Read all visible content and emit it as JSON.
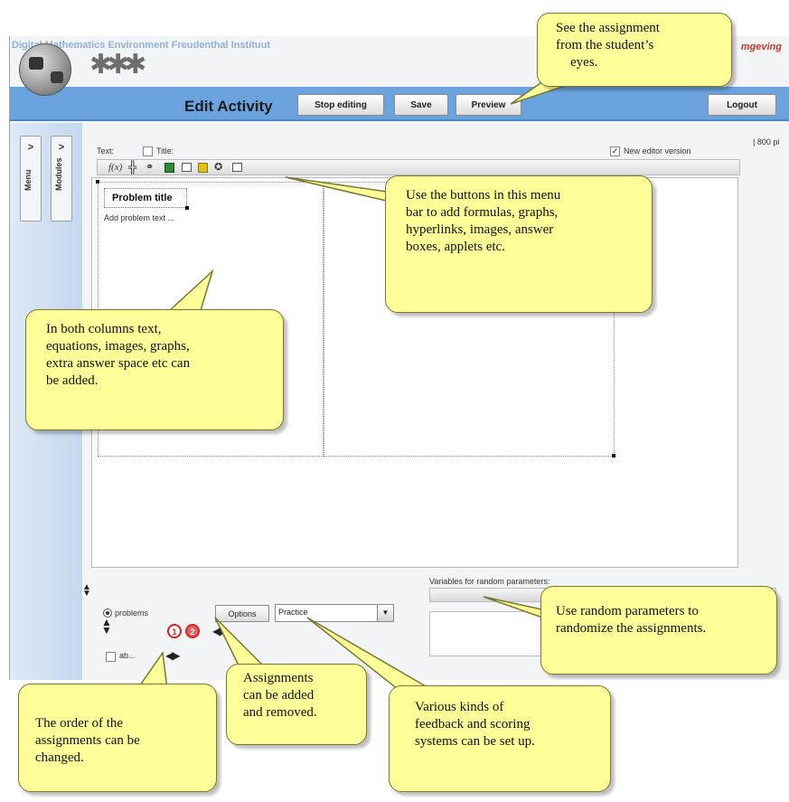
{
  "app": {
    "title": "Digital Mathematics Environment  Freudenthal Instituut",
    "title_right": "mgeving",
    "page_heading": "Edit Activity",
    "buttons": {
      "stop_editing": "Stop editing",
      "save": "Save",
      "preview": "Preview",
      "logout": "Logout"
    },
    "side_tabs": [
      {
        "chevron": ">",
        "label": "Menu"
      },
      {
        "chevron": ">",
        "label": "Modules"
      }
    ]
  },
  "editor": {
    "text_label": "Text:",
    "title_label": "Title:",
    "new_editor_label": "New editor version",
    "new_editor_checked": true,
    "size_label": "| 800 pi",
    "toolbar": {
      "formula": "f(x)",
      "icons": [
        "formula-icon",
        "graph-icon",
        "hyperlink-icon",
        "image-icon",
        "answer-box-icon",
        "applet-icon",
        "extra-icon",
        "misc-icon"
      ]
    },
    "problem_title": "Problem title",
    "problem_text": "Add problem text ..."
  },
  "variables": {
    "label": "Variables for random parameters:"
  },
  "bottom": {
    "problems_label": "problems",
    "options_button": "Options",
    "feedback_select": "Practice",
    "assignment_numbers": [
      "1",
      "2"
    ],
    "ab_label": "ab..."
  },
  "callouts": {
    "preview": [
      "See the assignment",
      "from the student’s",
      "eyes."
    ],
    "toolbar": [
      "Use the buttons in this menu",
      "bar to add formulas, graphs,",
      "hyperlinks, images, answer",
      "boxes, applets etc."
    ],
    "columns": [
      "In both columns text,",
      "equations, images, graphs,",
      "extra answer space etc can",
      "be added."
    ],
    "random": [
      "Use random parameters to",
      "randomize the assignments."
    ],
    "add_remove": [
      "Assignments",
      "can be added",
      "and removed."
    ],
    "feedback": [
      "Various kinds of",
      "feedback and scoring",
      "systems can be set up."
    ],
    "order": [
      "The order of the",
      "assignments can be",
      "changed."
    ]
  },
  "colors": {
    "banner": "#6aa3de",
    "callout_fill": "#ffff99",
    "title_text": "#8fb0e0",
    "assignment_red": "#d42424"
  }
}
